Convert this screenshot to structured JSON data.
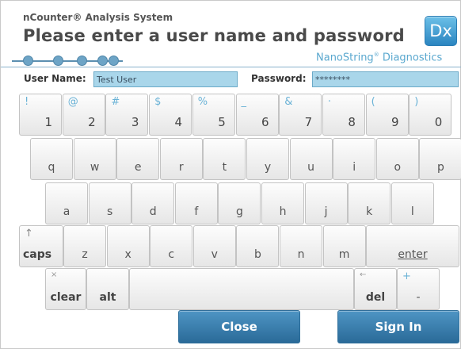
{
  "header": {
    "app_name": "nCounter® Analysis System",
    "prompt": "Please enter a user name and password",
    "logo_text": "Dx",
    "brand_name": "NanoString",
    "brand_mark": "®",
    "brand_suffix": " Diagnostics",
    "progress_dots": 5,
    "colors": {
      "accent": "#2b85c0",
      "field_bg": "#a9d6ea",
      "button": "#3a7fae"
    }
  },
  "form": {
    "username_label": "User Name:",
    "username_value": "Test User",
    "password_label": "Password:",
    "password_value": "********"
  },
  "keyboard": {
    "row1": [
      {
        "main": "1",
        "shift": "!"
      },
      {
        "main": "2",
        "shift": "@"
      },
      {
        "main": "3",
        "shift": "#"
      },
      {
        "main": "4",
        "shift": "$"
      },
      {
        "main": "5",
        "shift": "%"
      },
      {
        "main": "6",
        "shift": "_"
      },
      {
        "main": "7",
        "shift": "&"
      },
      {
        "main": "8",
        "shift": "·"
      },
      {
        "main": "9",
        "shift": "("
      },
      {
        "main": "0",
        "shift": ")"
      }
    ],
    "row2": [
      "q",
      "w",
      "e",
      "r",
      "t",
      "y",
      "u",
      "i",
      "o",
      "p"
    ],
    "row3": [
      "a",
      "s",
      "d",
      "f",
      "g",
      "h",
      "j",
      "k",
      "l"
    ],
    "row4": [
      "z",
      "x",
      "c",
      "v",
      "b",
      "n",
      "m"
    ],
    "caps_label": "caps",
    "caps_icon": "up-arrow-icon",
    "enter_label": "enter",
    "clear_label": "clear",
    "clear_icon": "×",
    "alt_label": "alt",
    "del_label": "del",
    "del_icon": "←",
    "minus_label": "-",
    "plus_label": "+"
  },
  "actions": {
    "close_label": "Close",
    "signin_label": "Sign In"
  }
}
